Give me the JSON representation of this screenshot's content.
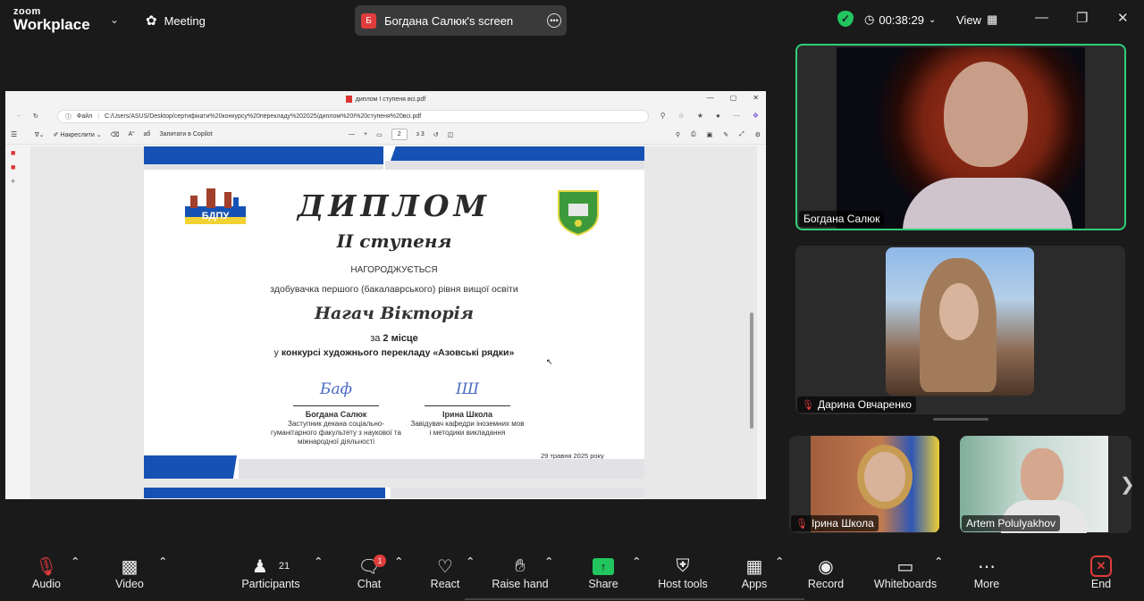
{
  "app": {
    "brand_top": "zoom",
    "brand_bottom": "Workplace",
    "meeting_label": "Meeting"
  },
  "share_pill": {
    "avatar_letter": "Б",
    "label": "Богдана Салюк's screen"
  },
  "status": {
    "timer": "00:38:29",
    "view_label": "View",
    "secure_color": "#22c55e"
  },
  "pdf": {
    "tab_title": "диплом І ступеня всі.pdf",
    "url_prefix": "Файл",
    "url": "C:/Users/ASUS/Desktop/сертифікати%20конкурсу%20перекладу%202025/диплом%20І%20ступеня%20всі.pdf",
    "toolbar": {
      "draw": "Накреслити",
      "copilot": "Запитати в Copilot",
      "page_current": "2",
      "page_total": "з 3"
    },
    "diploma": {
      "title": "ДИПЛОМ",
      "degree": "II ступеня",
      "awards": "НАГОРОДЖУЄТЬСЯ",
      "recipient_desc": "здобувачка першого (бакалаврського) рівня вищої освіти",
      "recipient": "Нагач Вікторія",
      "place_prefix": "за",
      "place": "2 місце",
      "contest_prefix": "у",
      "contest": "конкурсі художнього перекладу «Азовські рядки»",
      "sig1_script": "Баф",
      "sig1_name": "Богдана Салюк",
      "sig1_role": "Заступник декана соціально-гуманітарного факультету з наукової та міжнародної діяльності",
      "sig2_script": "ІШ",
      "sig2_name": "Ірина Школа",
      "sig2_role": "Завідувач кафедри іноземних мов і методики викладання",
      "date": "29 травня 2025 року",
      "logo_left_text": "БДПУ"
    }
  },
  "participants_tiles": [
    {
      "name": "Богдана Салюк",
      "muted": false,
      "speaking": true
    },
    {
      "name": "Дарина Овчаренко",
      "muted": true,
      "speaking": false
    },
    {
      "name": "Ірина Школа",
      "muted": true,
      "speaking": false
    },
    {
      "name": "Artem Polulyakhov",
      "muted": false,
      "speaking": false
    }
  ],
  "toolbar": {
    "audio": "Audio",
    "video": "Video",
    "participants": "Participants",
    "participants_count": "21",
    "chat": "Chat",
    "chat_badge": "1",
    "react": "React",
    "raise_hand": "Raise hand",
    "share": "Share",
    "host_tools": "Host tools",
    "apps": "Apps",
    "record": "Record",
    "whiteboards": "Whiteboards",
    "more": "More",
    "end": "End"
  }
}
